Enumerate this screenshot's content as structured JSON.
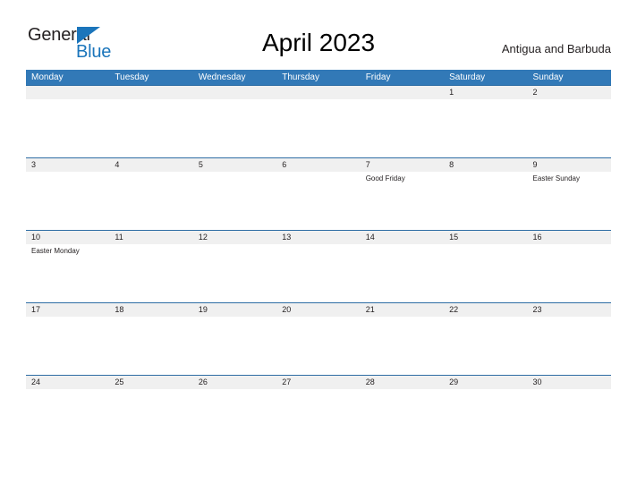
{
  "brand": {
    "name_part1": "General",
    "name_part2": "Blue",
    "triangle_icon": "triangle-icon",
    "color_dark": "#231f20",
    "color_blue": "#1b75bb"
  },
  "header": {
    "title": "April 2023",
    "country": "Antigua and Barbuda"
  },
  "theme": {
    "header_blue": "#3279b7",
    "row_rule_blue": "#2e6da4",
    "day_band_gray": "#f0f0f0",
    "text_dark": "#231f20"
  },
  "calendar": {
    "weekdays": [
      "Monday",
      "Tuesday",
      "Wednesday",
      "Thursday",
      "Friday",
      "Saturday",
      "Sunday"
    ],
    "weeks": [
      {
        "days": [
          {
            "num": "",
            "event": ""
          },
          {
            "num": "",
            "event": ""
          },
          {
            "num": "",
            "event": ""
          },
          {
            "num": "",
            "event": ""
          },
          {
            "num": "",
            "event": ""
          },
          {
            "num": "1",
            "event": ""
          },
          {
            "num": "2",
            "event": ""
          }
        ]
      },
      {
        "days": [
          {
            "num": "3",
            "event": ""
          },
          {
            "num": "4",
            "event": ""
          },
          {
            "num": "5",
            "event": ""
          },
          {
            "num": "6",
            "event": ""
          },
          {
            "num": "7",
            "event": "Good Friday"
          },
          {
            "num": "8",
            "event": ""
          },
          {
            "num": "9",
            "event": "Easter Sunday"
          }
        ]
      },
      {
        "days": [
          {
            "num": "10",
            "event": "Easter Monday"
          },
          {
            "num": "11",
            "event": ""
          },
          {
            "num": "12",
            "event": ""
          },
          {
            "num": "13",
            "event": ""
          },
          {
            "num": "14",
            "event": ""
          },
          {
            "num": "15",
            "event": ""
          },
          {
            "num": "16",
            "event": ""
          }
        ]
      },
      {
        "days": [
          {
            "num": "17",
            "event": ""
          },
          {
            "num": "18",
            "event": ""
          },
          {
            "num": "19",
            "event": ""
          },
          {
            "num": "20",
            "event": ""
          },
          {
            "num": "21",
            "event": ""
          },
          {
            "num": "22",
            "event": ""
          },
          {
            "num": "23",
            "event": ""
          }
        ]
      },
      {
        "days": [
          {
            "num": "24",
            "event": ""
          },
          {
            "num": "25",
            "event": ""
          },
          {
            "num": "26",
            "event": ""
          },
          {
            "num": "27",
            "event": ""
          },
          {
            "num": "28",
            "event": ""
          },
          {
            "num": "29",
            "event": ""
          },
          {
            "num": "30",
            "event": ""
          }
        ]
      }
    ]
  }
}
